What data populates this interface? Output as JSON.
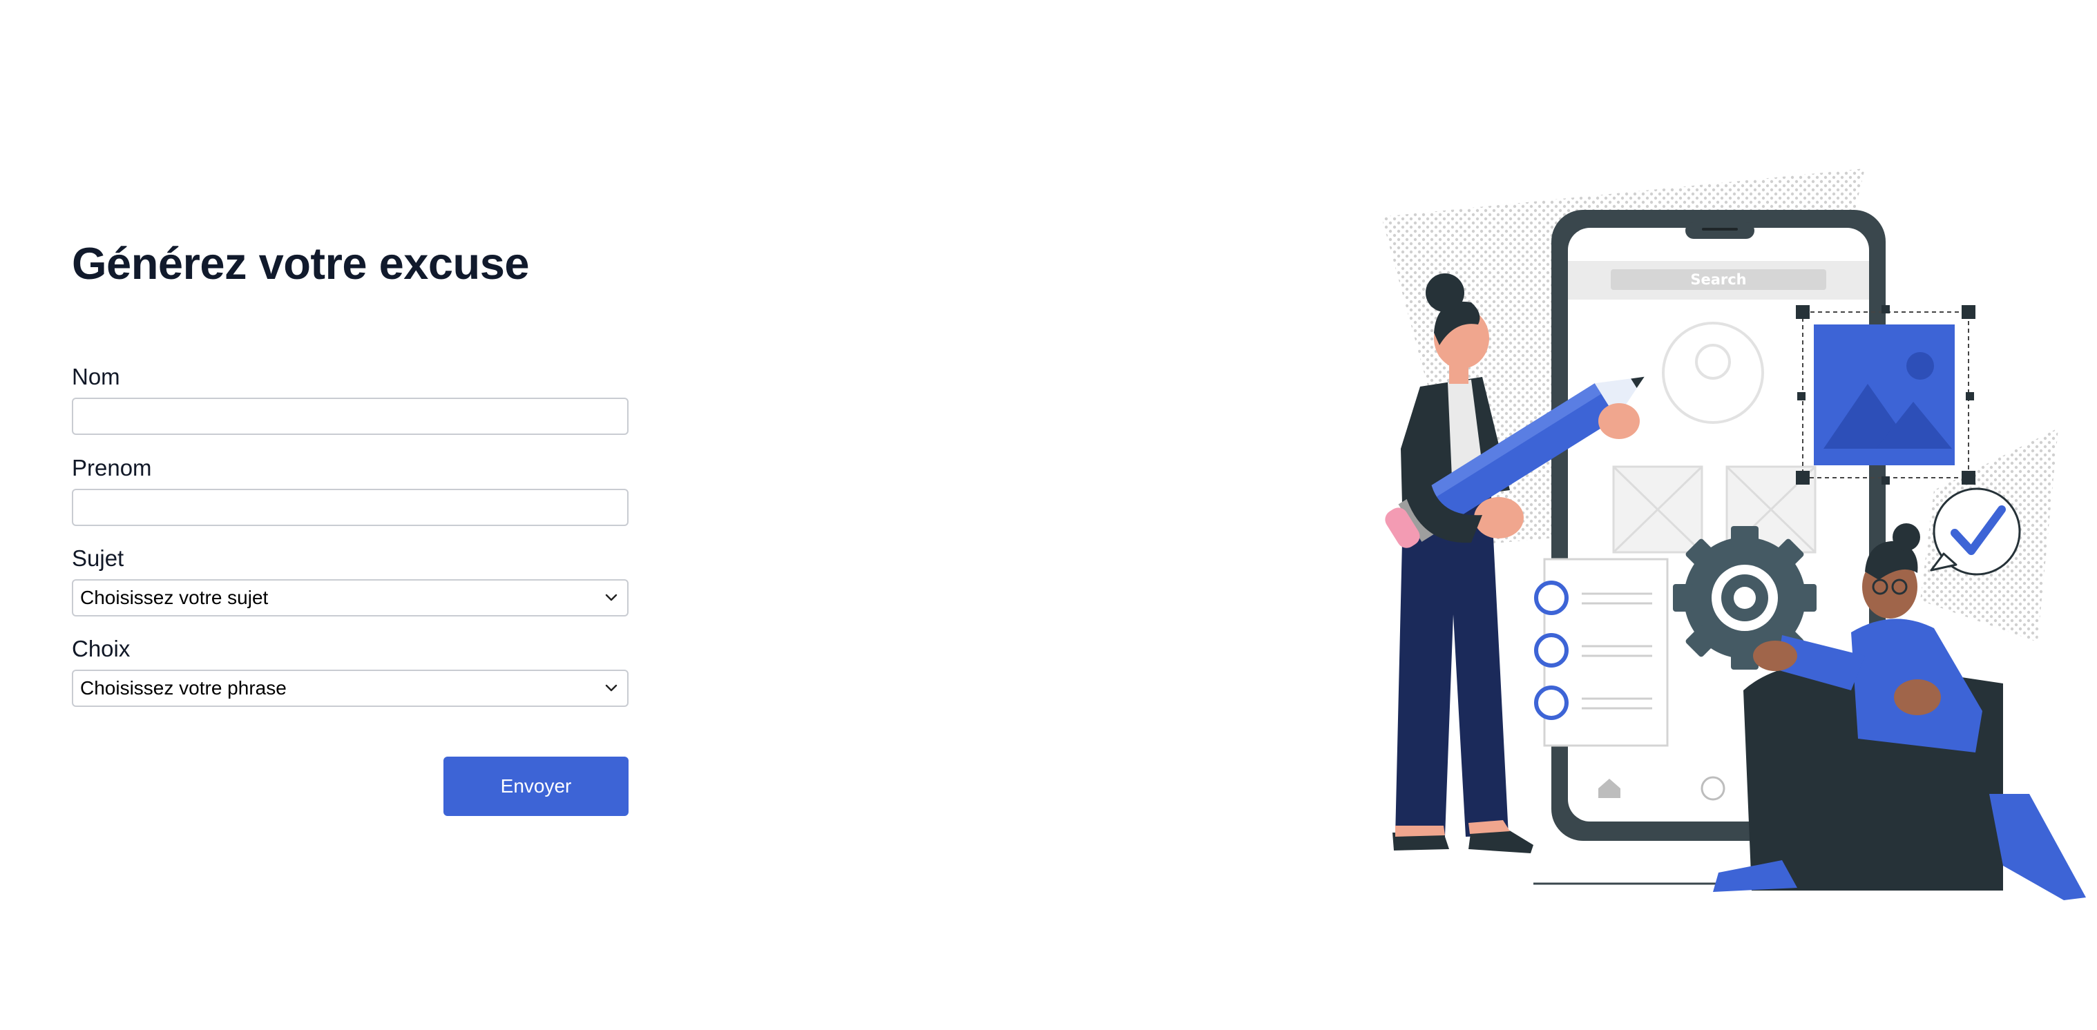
{
  "form": {
    "title": "Générez votre excuse",
    "fields": {
      "nom": {
        "label": "Nom",
        "value": ""
      },
      "prenom": {
        "label": "Prenom",
        "value": ""
      },
      "sujet": {
        "label": "Sujet",
        "selected": "Choisissez votre sujet"
      },
      "choix": {
        "label": "Choix",
        "selected": "Choisissez votre phrase"
      }
    },
    "submit_label": "Envoyer"
  },
  "illustration": {
    "search_label": "Search"
  },
  "colors": {
    "accent": "#3d64d6",
    "title": "#111a2c",
    "dark": "#263238",
    "navy": "#1b2a5a",
    "skin": "#f0a68e",
    "skin_dark": "#a0654a"
  }
}
